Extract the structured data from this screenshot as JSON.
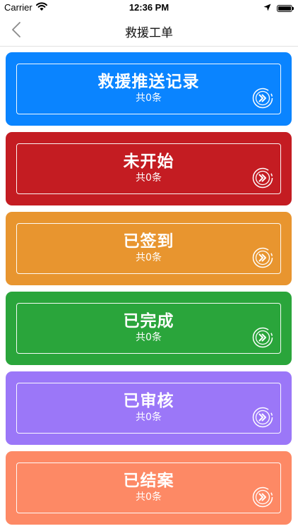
{
  "status_bar": {
    "carrier": "Carrier",
    "time": "12:36 PM"
  },
  "nav": {
    "title": "救援工单",
    "back_icon": "chevron-left-icon"
  },
  "cards": [
    {
      "title": "救援推送记录",
      "count": "共0条",
      "color": "#0a84ff"
    },
    {
      "title": "未开始",
      "count": "共0条",
      "color": "#c41c22"
    },
    {
      "title": "已签到",
      "count": "共0条",
      "color": "#e8952f"
    },
    {
      "title": "已完成",
      "count": "共0条",
      "color": "#2aa53b"
    },
    {
      "title": "已审核",
      "count": "共0条",
      "color": "#9b77f8"
    },
    {
      "title": "已结案",
      "count": "共0条",
      "color": "#fd8965"
    }
  ],
  "card_icon": "double-chevron-right-icon"
}
